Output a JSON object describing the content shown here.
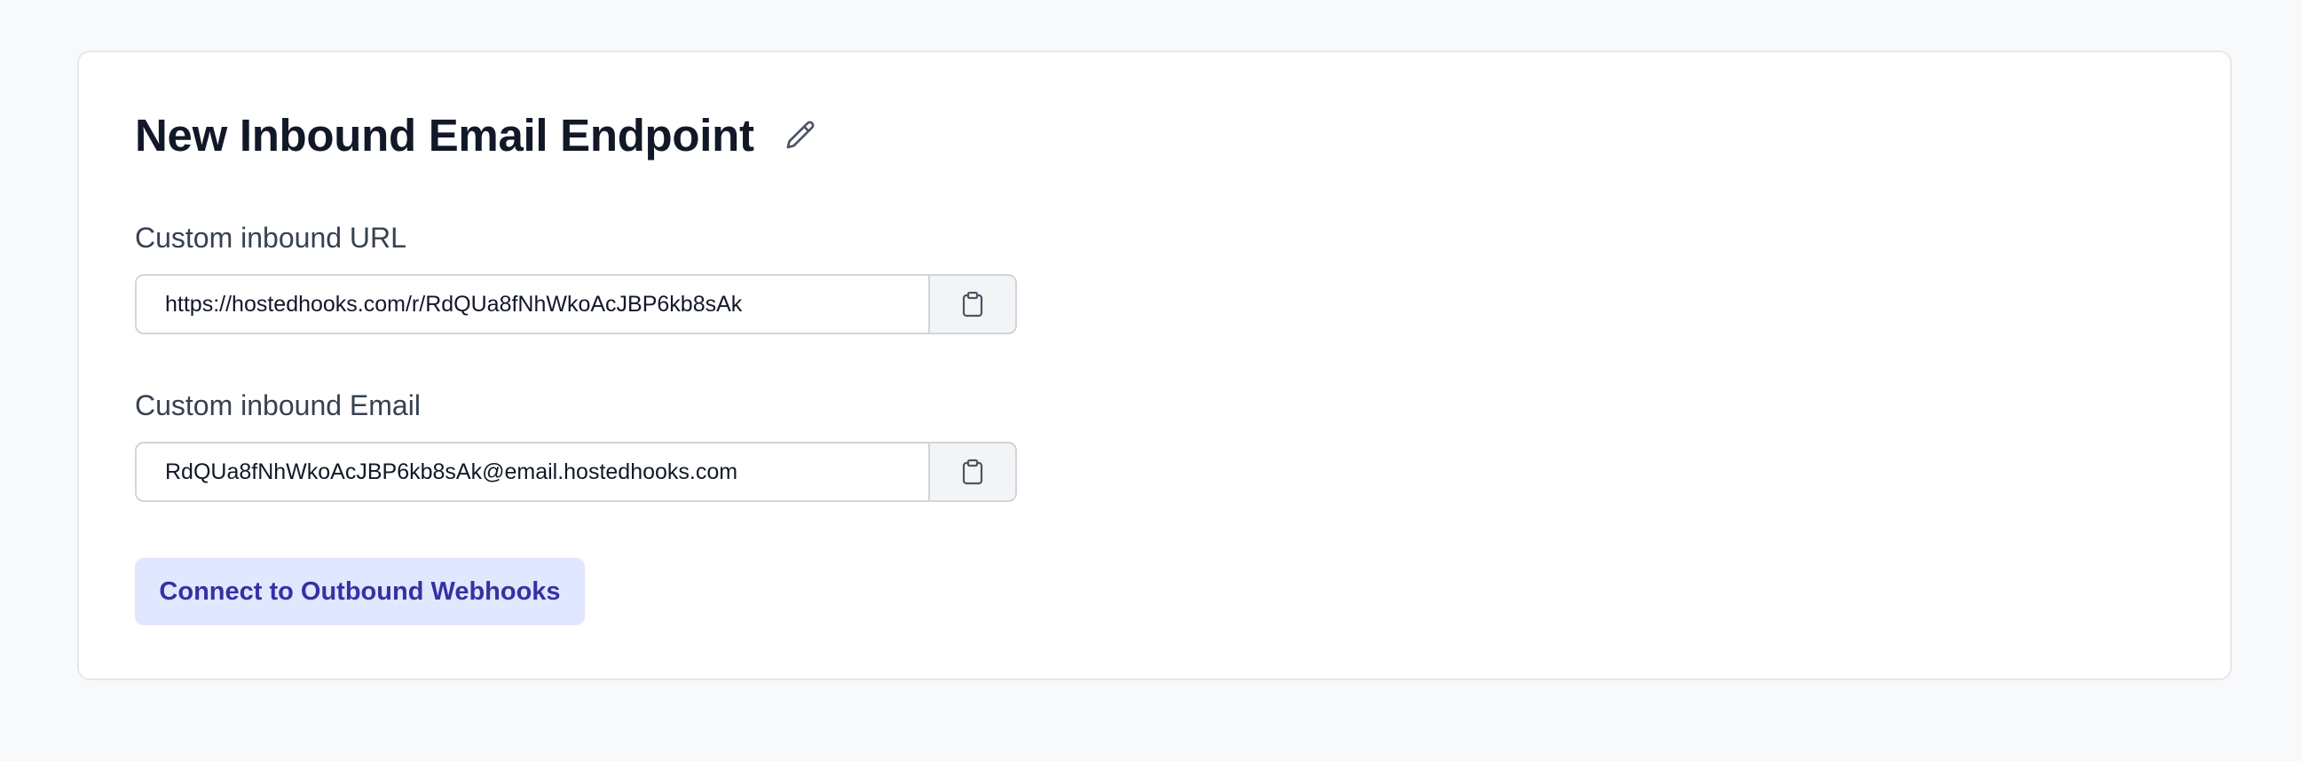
{
  "endpoint": {
    "title": "New Inbound Email Endpoint",
    "edit_icon": "pencil-icon"
  },
  "url_field": {
    "label": "Custom inbound URL",
    "value": "https://hostedhooks.com/r/RdQUa8fNhWkoAcJBP6kb8sAk",
    "copy_icon": "clipboard-icon"
  },
  "email_field": {
    "label": "Custom inbound Email",
    "value": "RdQUa8fNhWkoAcJBP6kb8sAk@email.hostedhooks.com",
    "copy_icon": "clipboard-icon"
  },
  "connect_button": {
    "label": "Connect to Outbound Webhooks"
  },
  "colors": {
    "page_background": "#f8f9fb",
    "card_background": "#ffffff",
    "title_text": "#111827",
    "button_background": "#e0e7ff",
    "button_text": "#3730a3"
  }
}
